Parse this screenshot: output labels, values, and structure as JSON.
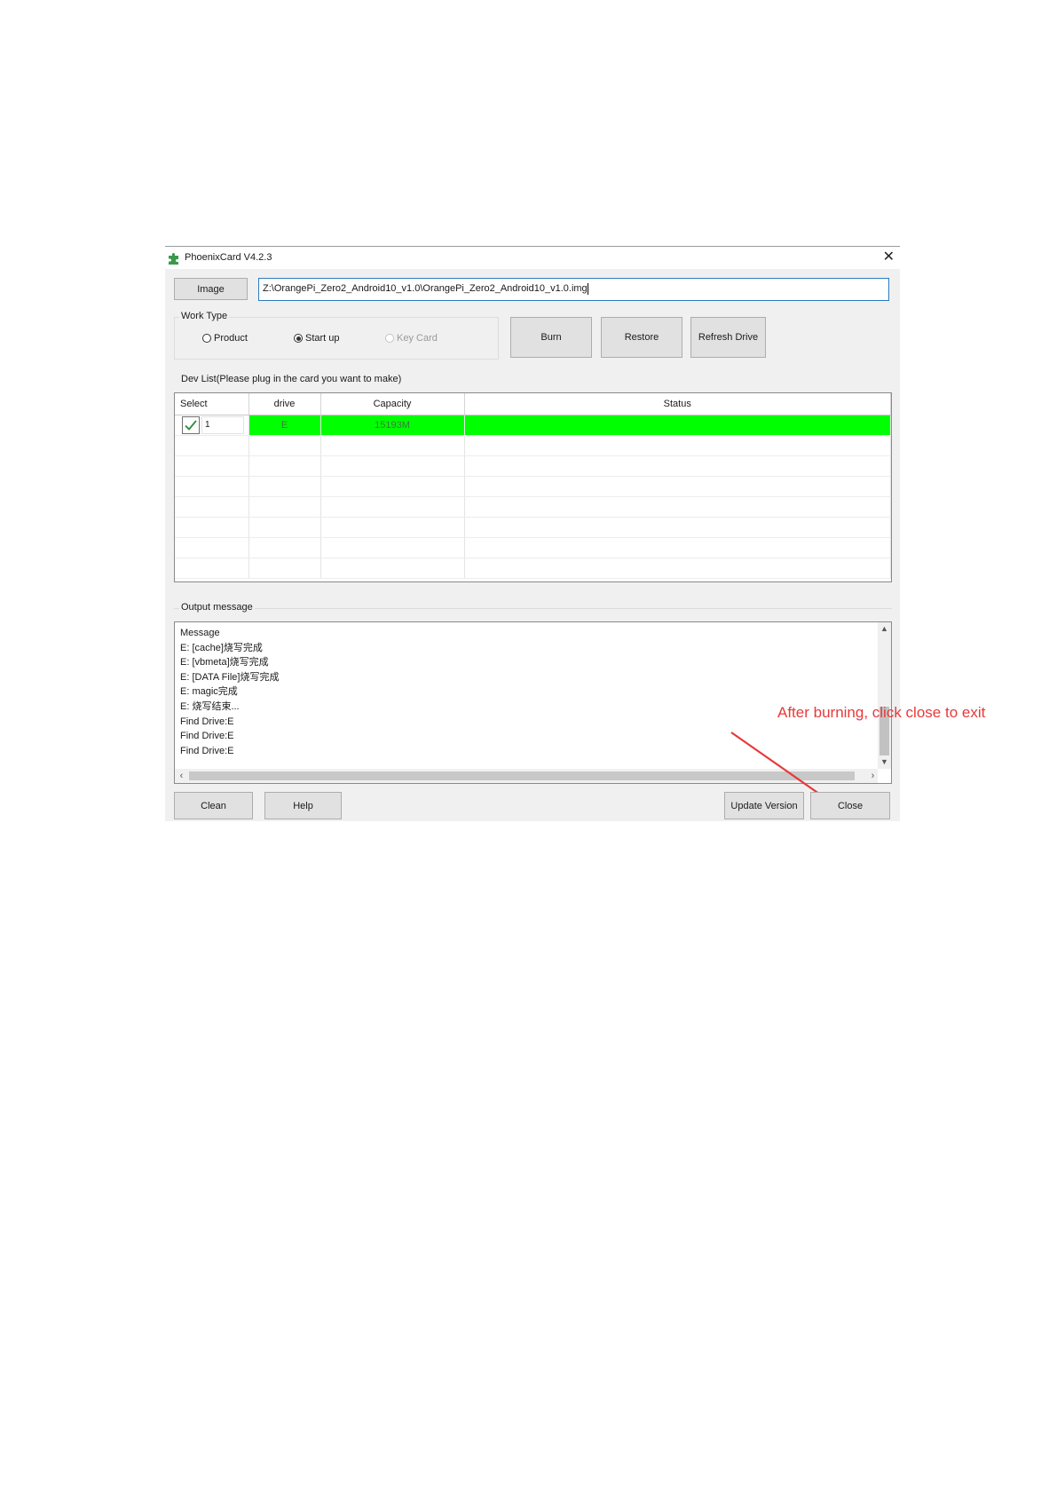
{
  "window": {
    "title": "PhoenixCard V4.2.3",
    "close_glyph": "✕",
    "icon": "puzzle-piece-icon"
  },
  "image": {
    "button_label": "Image",
    "path": "Z:\\OrangePi_Zero2_Android10_v1.0\\OrangePi_Zero2_Android10_v1.0.img"
  },
  "work_type": {
    "label": "Work Type",
    "options": [
      {
        "label": "Product",
        "selected": false,
        "enabled": true
      },
      {
        "label": "Start up",
        "selected": true,
        "enabled": true
      },
      {
        "label": "Key Card",
        "selected": false,
        "enabled": false
      }
    ]
  },
  "actions": {
    "burn": "Burn",
    "restore": "Restore",
    "refresh": "Refresh Drive"
  },
  "dev_list": {
    "label": "Dev List(Please plug in the card you want to make)",
    "columns": [
      "Select",
      "drive",
      "Capacity",
      "Status"
    ],
    "rows": [
      {
        "select": "1",
        "checked": true,
        "drive": "E",
        "capacity": "15193M",
        "status": "",
        "highlight": "#00ff00"
      }
    ]
  },
  "output": {
    "label": "Output message",
    "lines": [
      "Message",
      "E: [cache]烧写完成",
      "E: [vbmeta]烧写完成",
      "E: [DATA File]烧写完成",
      "E: magic完成",
      "E: 烧写结束...",
      "Find Drive:E",
      "Find Drive:E",
      "Find Drive:E"
    ]
  },
  "footer": {
    "clean": "Clean",
    "help": "Help",
    "update": "Update Version",
    "close": "Close"
  },
  "annotation": {
    "text": "After burning, click close to exit",
    "color": "#e8393a"
  }
}
